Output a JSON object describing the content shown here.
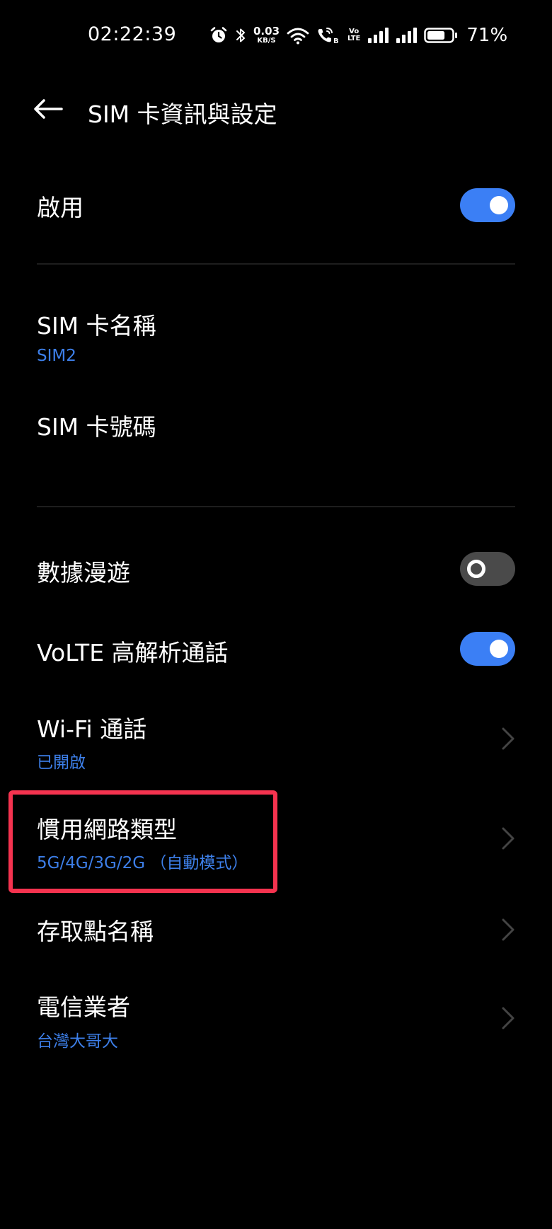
{
  "status_bar": {
    "time": "02:22:39",
    "net_speed_value": "0.03",
    "net_speed_unit": "KB/S",
    "volte_top": "Vo",
    "volte_bottom": "LTE",
    "sim_badge": "B",
    "battery_percent": "71%",
    "battery_level": 0.71,
    "icons": [
      "alarm-icon",
      "bluetooth-icon",
      "wifi-icon",
      "wifi-calling-icon",
      "signal-icon",
      "signal-icon",
      "battery-icon"
    ]
  },
  "header": {
    "title": "SIM 卡資訊與設定",
    "back_icon": "back-arrow-icon"
  },
  "settings": {
    "enable": {
      "title": "啟用",
      "toggle": "on"
    },
    "sim_name": {
      "title": "SIM 卡名稱",
      "value": "SIM2"
    },
    "sim_number": {
      "title": "SIM 卡號碼"
    },
    "data_roaming": {
      "title": "數據漫遊",
      "toggle": "off"
    },
    "volte": {
      "title": "VoLTE 高解析通話",
      "toggle": "on"
    },
    "wifi_calling": {
      "title": "Wi-Fi 通話",
      "value": "已開啟"
    },
    "preferred_network": {
      "title": "慣用網路類型",
      "value": "5G/4G/3G/2G （自動模式）"
    },
    "apn": {
      "title": "存取點名稱"
    },
    "carrier": {
      "title": "電信業者",
      "value": "台灣大哥大"
    }
  },
  "colors": {
    "background": "#000000",
    "accent": "#3b7ff5",
    "subtitle": "#3d7fe9",
    "toggle_off": "#4a4a4a",
    "highlight": "#f5334f"
  }
}
